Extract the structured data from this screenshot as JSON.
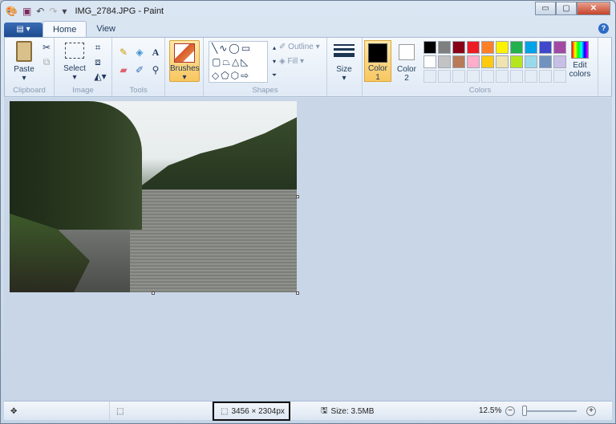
{
  "window": {
    "title": "IMG_2784.JPG - Paint",
    "controls": {
      "minimize": "▭",
      "maximize": "▢",
      "close": "✕"
    }
  },
  "quick_access": {
    "save": "save-icon",
    "undo": "undo-icon",
    "redo": "redo-icon",
    "customize": "▾"
  },
  "tabs": {
    "file": "▤ ▾",
    "home": "Home",
    "view": "View",
    "help": "?"
  },
  "ribbon": {
    "clipboard": {
      "label": "Clipboard",
      "paste": "Paste"
    },
    "image": {
      "label": "Image",
      "select": "Select"
    },
    "tools": {
      "label": "Tools"
    },
    "brushes": {
      "label": "Brushes"
    },
    "shapes": {
      "label": "Shapes",
      "outline": "Outline",
      "fill": "Fill"
    },
    "size": {
      "label": "Size"
    },
    "colors": {
      "label": "Colors",
      "color1": "Color 1",
      "color2": "Color 2",
      "edit": "Edit colors",
      "palette_row1": [
        "#000000",
        "#7f7f7f",
        "#880015",
        "#ed1c24",
        "#ff7f27",
        "#fff200",
        "#22b14c",
        "#00a2e8",
        "#3f48cc",
        "#a349a4"
      ],
      "palette_row2": [
        "#ffffff",
        "#c3c3c3",
        "#b97a57",
        "#ffaec9",
        "#ffc90e",
        "#efe4b0",
        "#b5e61d",
        "#99d9ea",
        "#7092be",
        "#c8bfe7"
      ],
      "color1_value": "#000000",
      "color2_value": "#ffffff"
    }
  },
  "status": {
    "dimensions": "3456 × 2304px",
    "size": "Size: 3.5MB",
    "zoom": "12.5%",
    "zoom_minus": "−",
    "zoom_plus": "+"
  }
}
